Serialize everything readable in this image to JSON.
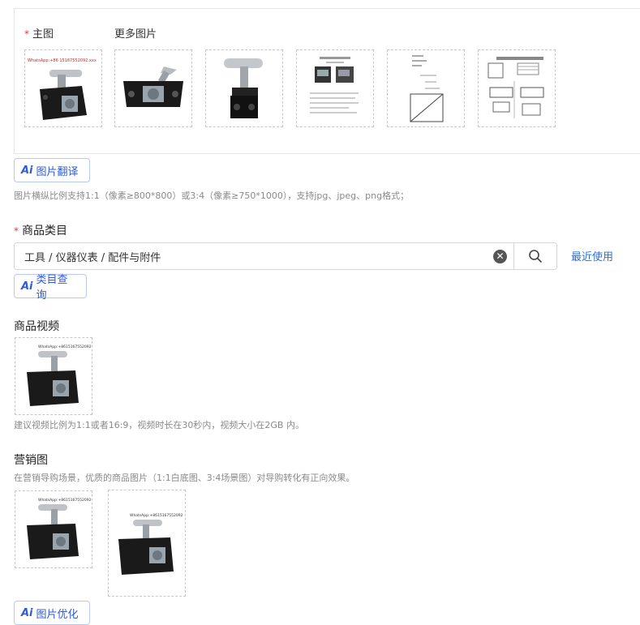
{
  "main_images": {
    "main_label_star": "*",
    "main_label": "主图",
    "more_label": "更多图片",
    "thumbs": [
      "product-front",
      "product-back",
      "product-side",
      "spec-document",
      "dimension-drawing",
      "technical-drawing"
    ],
    "watermark": "WhatsApp:+86 15167552092.xxx"
  },
  "translate_button": {
    "ai": "Ai",
    "label": "图片翻译"
  },
  "image_hint": "图片横纵比例支持1:1（像素≥800*800）或3:4（像素≥750*1000），支持jpg、jpeg、png格式；",
  "category": {
    "star": "*",
    "title": "商品类目",
    "value": "工具 / 仪器仪表 / 配件与附件",
    "clear_icon": "close-circle-icon",
    "search_icon": "search-icon",
    "recent": "最近使用"
  },
  "category_query_button": {
    "ai": "Ai",
    "label": "类目查询"
  },
  "video": {
    "title": "商品视频",
    "hint": "建议视频比例为1:1或者16:9，视频时长在30秒内，视频大小在2GB 内。",
    "watermark": "WhatsApp:+8615167552092"
  },
  "marketing": {
    "title": "营销图",
    "hint": "在营销导购场景，优质的商品图片（1:1白底图、3:4场景图）对导购转化有正向效果。",
    "watermark": "WhatsApp:+8615167552092"
  },
  "optimize_button": {
    "ai": "Ai",
    "label": "图片优化"
  }
}
